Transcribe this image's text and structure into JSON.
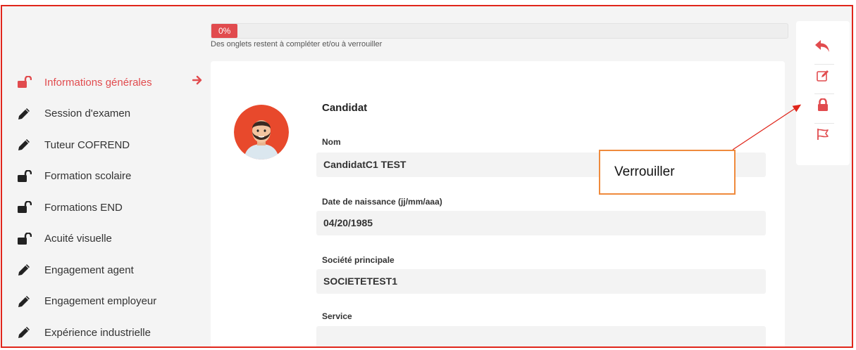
{
  "progress": {
    "percent_label": "0%",
    "percent": 0,
    "message": "Des onglets restent à compléter et/ou à verrouiller"
  },
  "sidebar": {
    "items": [
      {
        "label": "Informations générales",
        "icon": "unlock-icon",
        "active": true
      },
      {
        "label": "Session d'examen",
        "icon": "pencil-icon"
      },
      {
        "label": "Tuteur COFREND",
        "icon": "pencil-icon"
      },
      {
        "label": "Formation scolaire",
        "icon": "unlock-icon"
      },
      {
        "label": "Formations END",
        "icon": "unlock-icon"
      },
      {
        "label": "Acuité visuelle",
        "icon": "unlock-icon"
      },
      {
        "label": "Engagement agent",
        "icon": "pencil-icon"
      },
      {
        "label": "Engagement employeur",
        "icon": "pencil-icon"
      },
      {
        "label": "Expérience industrielle",
        "icon": "pencil-icon"
      }
    ]
  },
  "form": {
    "section_title": "Candidat",
    "fields": [
      {
        "label": "Nom",
        "value": "CandidatC1 TEST"
      },
      {
        "label": "Date de naissance (jj/mm/aaa)",
        "value": "04/20/1985"
      },
      {
        "label": "Société principale",
        "value": "SOCIETETEST1"
      },
      {
        "label": "Service",
        "value": ""
      }
    ]
  },
  "toolbar": {
    "icons": [
      "reply-icon",
      "edit-icon",
      "lock-icon",
      "flag-icon"
    ]
  },
  "annotation": {
    "text": "Verrouiller"
  },
  "colors": {
    "accent": "#e14b4e",
    "frame": "#e0261b",
    "annotation_border": "#ef8a3c",
    "annotation_arrow": "#e0261b"
  }
}
